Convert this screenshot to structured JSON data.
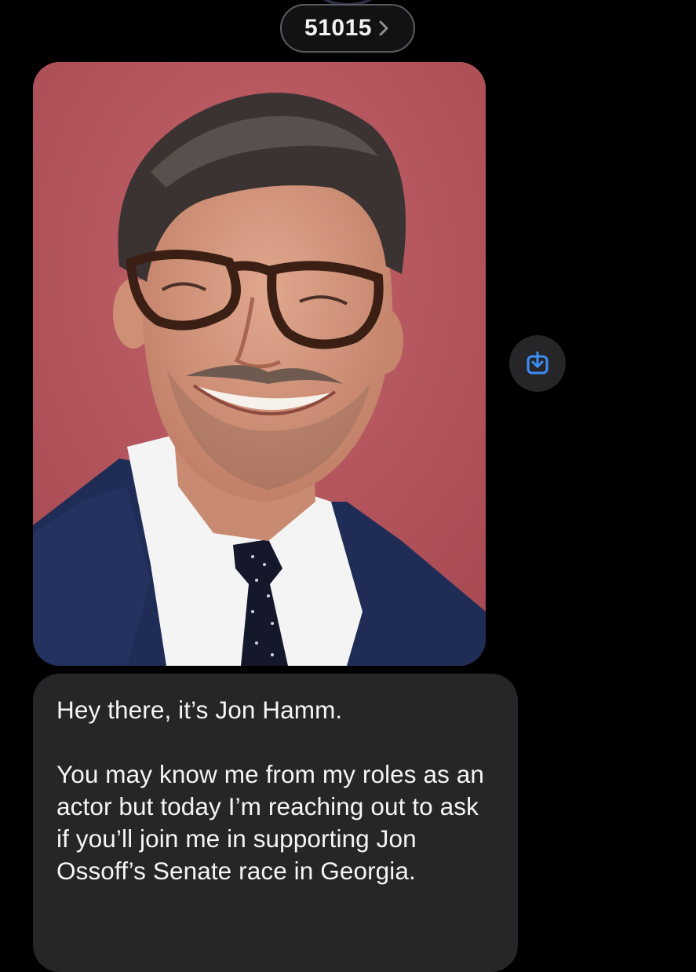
{
  "header": {
    "contact_number": "51015",
    "chevron_icon": "chevron-right-icon"
  },
  "thread": {
    "photo": {
      "description_icon": "portrait-photo"
    },
    "save_button": {
      "icon": "save-to-device-icon",
      "accent": "#3a8ef6"
    },
    "message": {
      "paragraphs": [
        "Hey there, it’s Jon Hamm.",
        "You may know me from my roles as an actor but today I’m reaching out to ask if you’ll join me in supporting Jon Ossoff’s Senate race in Georgia."
      ]
    }
  },
  "colors": {
    "background": "#000000",
    "bubble": "#262628",
    "photo_backdrop": "#b7545c"
  }
}
